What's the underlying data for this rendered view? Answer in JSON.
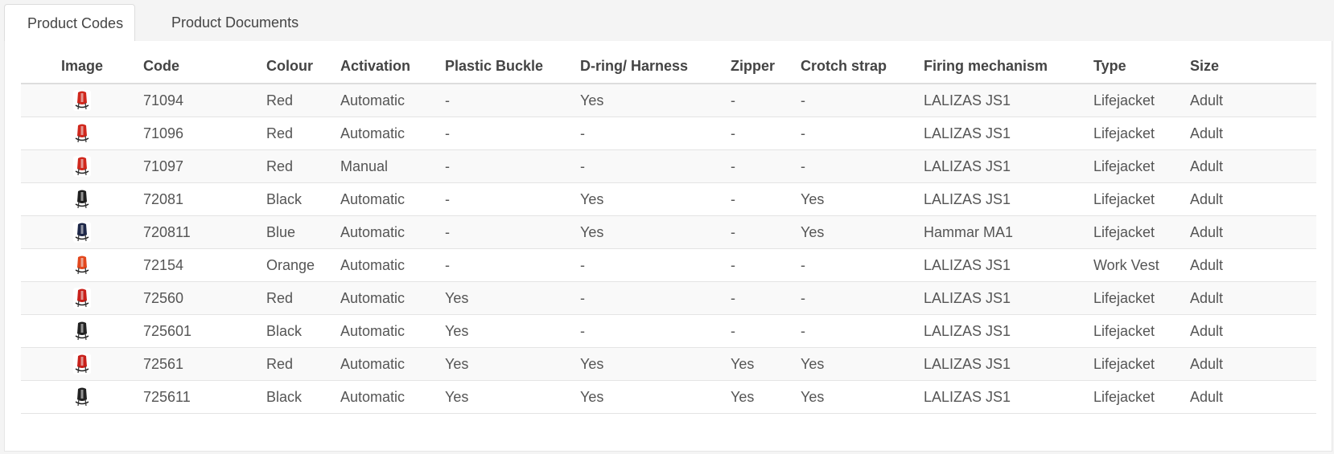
{
  "tabs": [
    {
      "label": "Product Codes",
      "active": true
    },
    {
      "label": "Product Documents",
      "active": false
    }
  ],
  "table": {
    "headers": [
      "Image",
      "Code",
      "Colour",
      "Activation",
      "Plastic Buckle",
      "D-ring/ Harness",
      "Zipper",
      "Crotch strap",
      "Firing mechanism",
      "Type",
      "Size"
    ],
    "rows": [
      {
        "icon": "red-lifejacket-icon",
        "color": "#d0281d",
        "cells": [
          "71094",
          "Red",
          "Automatic",
          "-",
          "Yes",
          "-",
          "-",
          "LALIZAS JS1",
          "Lifejacket",
          "Adult"
        ]
      },
      {
        "icon": "red-lifejacket-icon",
        "color": "#d0281d",
        "cells": [
          "71096",
          "Red",
          "Automatic",
          "-",
          "-",
          "-",
          "-",
          "LALIZAS JS1",
          "Lifejacket",
          "Adult"
        ]
      },
      {
        "icon": "red-lifejacket-icon",
        "color": "#d0281d",
        "cells": [
          "71097",
          "Red",
          "Manual",
          "-",
          "-",
          "-",
          "-",
          "LALIZAS JS1",
          "Lifejacket",
          "Adult"
        ]
      },
      {
        "icon": "black-lifejacket-icon",
        "color": "#1f1f1f",
        "cells": [
          "72081",
          "Black",
          "Automatic",
          "-",
          "Yes",
          "-",
          "Yes",
          "LALIZAS JS1",
          "Lifejacket",
          "Adult"
        ]
      },
      {
        "icon": "blue-lifejacket-icon",
        "color": "#1d2748",
        "cells": [
          "720811",
          "Blue",
          "Automatic",
          "-",
          "Yes",
          "-",
          "Yes",
          "Hammar MA1",
          "Lifejacket",
          "Adult"
        ]
      },
      {
        "icon": "orange-work-vest-icon",
        "color": "#e2471d",
        "cells": [
          "72154",
          "Orange",
          "Automatic",
          "-",
          "-",
          "-",
          "-",
          "LALIZAS JS1",
          "Work Vest",
          "Adult"
        ]
      },
      {
        "icon": "red-lifejacket-icon",
        "color": "#c8201a",
        "cells": [
          "72560",
          "Red",
          "Automatic",
          "Yes",
          "-",
          "-",
          "-",
          "LALIZAS JS1",
          "Lifejacket",
          "Adult"
        ]
      },
      {
        "icon": "black-lifejacket-icon",
        "color": "#222222",
        "cells": [
          "725601",
          "Black",
          "Automatic",
          "Yes",
          "-",
          "-",
          "-",
          "LALIZAS JS1",
          "Lifejacket",
          "Adult"
        ]
      },
      {
        "icon": "red-lifejacket-icon",
        "color": "#c8201a",
        "cells": [
          "72561",
          "Red",
          "Automatic",
          "Yes",
          "Yes",
          "Yes",
          "Yes",
          "LALIZAS JS1",
          "Lifejacket",
          "Adult"
        ]
      },
      {
        "icon": "black-lifejacket-icon",
        "color": "#222222",
        "cells": [
          "725611",
          "Black",
          "Automatic",
          "Yes",
          "Yes",
          "Yes",
          "Yes",
          "LALIZAS JS1",
          "Lifejacket",
          "Adult"
        ]
      }
    ]
  }
}
